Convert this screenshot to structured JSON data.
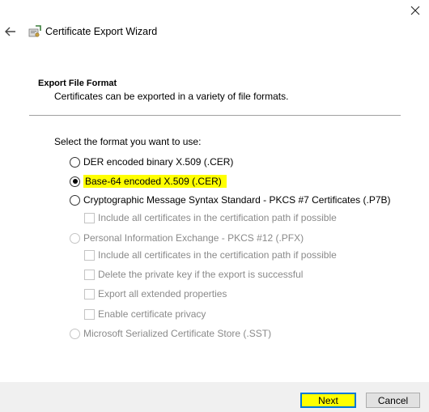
{
  "window": {
    "title": "Certificate Export Wizard"
  },
  "header": {
    "title": "Export File Format",
    "subtitle": "Certificates can be exported in a variety of file formats."
  },
  "prompt": "Select the format you want to use:",
  "options": {
    "der": {
      "label": "DER encoded binary X.509 (.CER)",
      "selected": false,
      "enabled": true
    },
    "base64": {
      "label": "Base-64 encoded X.509 (.CER)",
      "selected": true,
      "enabled": true
    },
    "pkcs7": {
      "label": "Cryptographic Message Syntax Standard - PKCS #7 Certificates (.P7B)",
      "selected": false,
      "enabled": true
    },
    "pkcs7_include": {
      "label": "Include all certificates in the certification path if possible",
      "checked": false,
      "enabled": false
    },
    "pfx": {
      "label": "Personal Information Exchange - PKCS #12 (.PFX)",
      "selected": false,
      "enabled": false
    },
    "pfx_include": {
      "label": "Include all certificates in the certification path if possible",
      "checked": false,
      "enabled": false
    },
    "pfx_delete_key": {
      "label": "Delete the private key if the export is successful",
      "checked": false,
      "enabled": false
    },
    "pfx_export_props": {
      "label": "Export all extended properties",
      "checked": false,
      "enabled": false
    },
    "pfx_privacy": {
      "label": "Enable certificate privacy",
      "checked": false,
      "enabled": false
    },
    "sst": {
      "label": "Microsoft Serialized Certificate Store (.SST)",
      "selected": false,
      "enabled": false
    }
  },
  "buttons": {
    "next": "Next",
    "cancel": "Cancel"
  },
  "colors": {
    "highlight": "#ffff00",
    "focus_border": "#0078d7",
    "footer": "#f0f0f0"
  }
}
